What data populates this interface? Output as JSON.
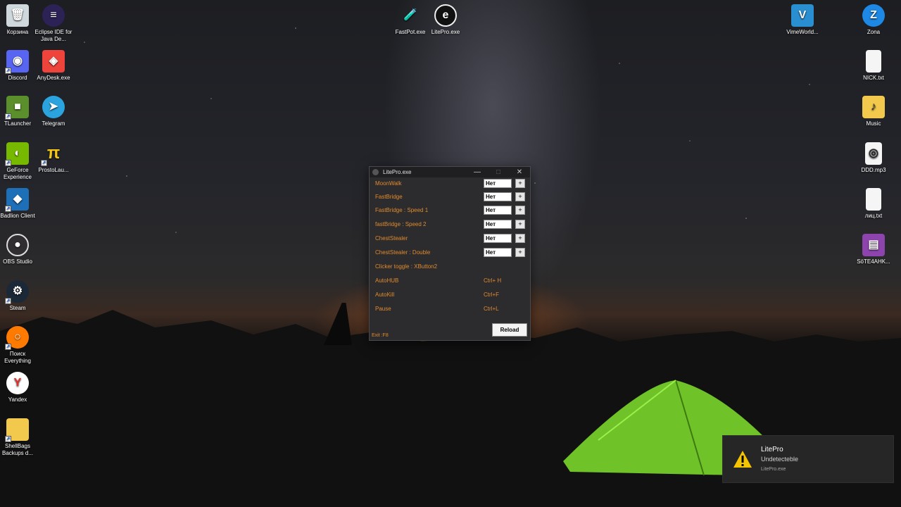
{
  "desktop": {
    "left_col1": [
      {
        "label": "Корзина",
        "icon": "recycle-bin-icon",
        "color": "#cfd8dc"
      },
      {
        "label": "Discord",
        "icon": "discord-icon",
        "color": "#5865f2"
      },
      {
        "label": "TLauncher",
        "icon": "tlauncher-icon",
        "color": "#5a8f2b"
      },
      {
        "label": "GeForce Experience",
        "icon": "geforce-icon",
        "color": "#76b900"
      },
      {
        "label": "Badlion Client",
        "icon": "badlion-icon",
        "color": "#1d6fb8"
      },
      {
        "label": "OBS Studio",
        "icon": "obs-icon",
        "color": "#302e31"
      },
      {
        "label": "Steam",
        "icon": "steam-icon",
        "color": "#1b2838"
      },
      {
        "label": "Поиск Everything",
        "icon": "everything-icon",
        "color": "#ff7a00"
      },
      {
        "label": "Yandex",
        "icon": "yandex-icon",
        "color": "#ffffff"
      },
      {
        "label": "ShellBags Backups d...",
        "icon": "folder-icon",
        "color": "#f2c94c"
      }
    ],
    "left_col2": [
      {
        "label": "Eclipse IDE for Java De...",
        "icon": "eclipse-icon",
        "color": "#2c2255"
      },
      {
        "label": "AnyDesk.exe",
        "icon": "anydesk-icon",
        "color": "#ef443b"
      },
      {
        "label": "Telegram",
        "icon": "telegram-icon",
        "color": "#2aa3df"
      },
      {
        "label": "ProstoLau...",
        "icon": "prostolauncher-icon",
        "color": "#f5c518"
      }
    ],
    "top_center": [
      {
        "label": "FastPot.exe",
        "icon": "fastpot-icon",
        "color": "#e84c3d"
      },
      {
        "label": "LitePro.exe",
        "icon": "litepro-icon",
        "color": "#111111"
      }
    ],
    "right_col1": [
      {
        "label": "VimeWorld...",
        "icon": "vimeworld-icon",
        "color": "#2a8fd0"
      }
    ],
    "right_col2": [
      {
        "label": "Zona",
        "icon": "zona-icon",
        "color": "#1e88e5"
      },
      {
        "label": "NICK.txt",
        "icon": "text-file-icon",
        "color": "#f5f5f5"
      },
      {
        "label": "Music",
        "icon": "music-folder-icon",
        "color": "#f2c94c"
      },
      {
        "label": "DDD.mp3",
        "icon": "audio-file-icon",
        "color": "#f5f5f5"
      },
      {
        "label": "лиц.txt",
        "icon": "text-file-icon",
        "color": "#f5f5f5"
      },
      {
        "label": "SöTE4AHK...",
        "icon": "winrar-icon",
        "color": "#8e44ad"
      }
    ]
  },
  "window": {
    "title": "LitePro.exe",
    "minimize": "—",
    "maximize": "□",
    "close": "✕",
    "options": [
      {
        "label": "MoonWalk",
        "value": "Нет"
      },
      {
        "label": "FastBridge",
        "value": "Нет"
      },
      {
        "label": "FastBridge : Speed 1",
        "value": "Нет"
      },
      {
        "label": "fastBridge : Speed 2",
        "value": "Нет"
      },
      {
        "label": "ChestStealer",
        "value": "Нет"
      },
      {
        "label": "ChestStealer : Double",
        "value": "Нет"
      }
    ],
    "plus_label": "+",
    "clicker_toggle": "Clicker toggle : XButton2",
    "hotkeys": [
      {
        "label": "AutoHUB",
        "key": "Ctrl+ H"
      },
      {
        "label": "AutoKill",
        "key": "Ctrl+F"
      },
      {
        "label": "Pause",
        "key": "Ctrl+L"
      }
    ],
    "reload": "Reload",
    "exit": "Exit :F8",
    "accent": "#e28a2b"
  },
  "toast": {
    "title": "LitePro",
    "body": "Undetecteble",
    "source": "LitePro.exe",
    "icon": "warning-icon"
  }
}
